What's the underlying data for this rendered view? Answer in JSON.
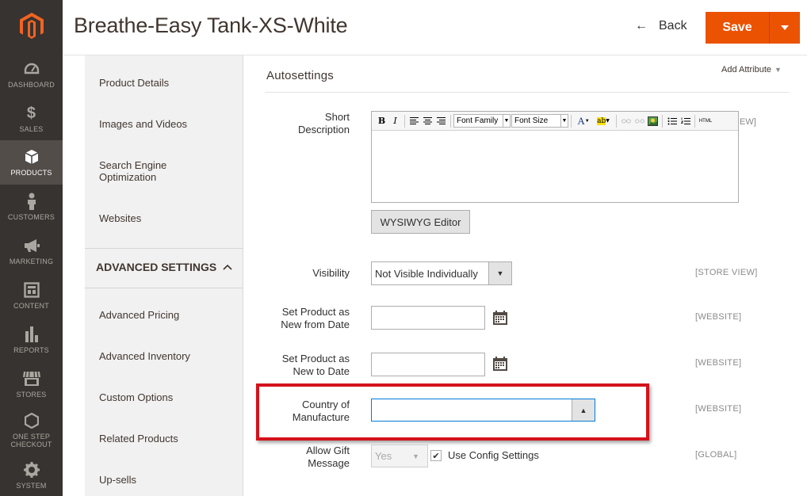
{
  "nav": {
    "items": [
      {
        "label": "DASHBOARD",
        "icon": "dashboard-icon"
      },
      {
        "label": "SALES",
        "icon": "dollar-icon"
      },
      {
        "label": "PRODUCTS",
        "icon": "cube-icon",
        "active": true
      },
      {
        "label": "CUSTOMERS",
        "icon": "person-icon"
      },
      {
        "label": "MARKETING",
        "icon": "megaphone-icon"
      },
      {
        "label": "CONTENT",
        "icon": "layout-icon"
      },
      {
        "label": "REPORTS",
        "icon": "bar-chart-icon"
      },
      {
        "label": "STORES",
        "icon": "storefront-icon"
      },
      {
        "label": "ONE STEP CHECKOUT",
        "icon": "hexagon-icon"
      },
      {
        "label": "SYSTEM",
        "icon": "gear-icon"
      }
    ]
  },
  "header": {
    "title": "Breathe-Easy Tank-XS-White",
    "back_label": "Back",
    "save_label": "Save"
  },
  "tabs": {
    "items": [
      "Product Details",
      "Images and Videos",
      "Search Engine Optimization",
      "Websites"
    ],
    "section_label": "ADVANCED SETTINGS",
    "advanced_items": [
      "Advanced Pricing",
      "Advanced Inventory",
      "Custom Options",
      "Related Products",
      "Up-sells"
    ]
  },
  "content": {
    "section_title": "Autosettings",
    "add_attribute": "Add Attribute",
    "short_description": {
      "label": "Short Description",
      "font_family": "Font Family",
      "font_size": "Font Size",
      "scope_fragment": "EW]",
      "wysiwyg_button": "WYSIWYG Editor"
    },
    "visibility": {
      "label": "Visibility",
      "value": "Not Visible Individually",
      "scope": "[STORE VIEW]"
    },
    "new_from": {
      "label": "Set Product as New from Date",
      "value": "",
      "scope": "[WEBSITE]"
    },
    "new_to": {
      "label": "Set Product as New to Date",
      "value": "",
      "scope": "[WEBSITE]"
    },
    "country": {
      "label": "Country of Manufacture",
      "value": "",
      "scope": "[WEBSITE]"
    },
    "gift": {
      "label": "Allow Gift Message",
      "value": "Yes",
      "checkbox_label": "Use Config Settings",
      "checked": true,
      "scope": "[GLOBAL]"
    }
  },
  "colors": {
    "accent": "#eb5202",
    "nav_bg": "#373330",
    "highlight_border": "#d4121b"
  }
}
